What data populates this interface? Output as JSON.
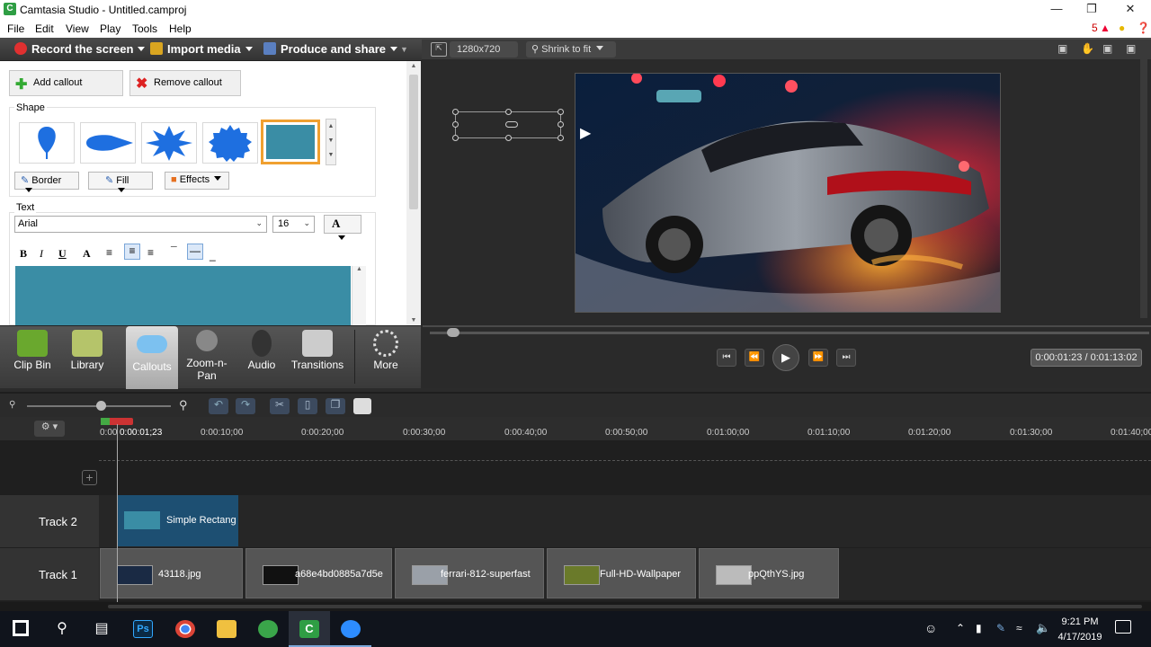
{
  "window": {
    "title": "Camtasia Studio - Untitled.camproj"
  },
  "menu": [
    "File",
    "Edit",
    "View",
    "Play",
    "Tools",
    "Help"
  ],
  "notifications_count": "5",
  "tasks": {
    "record": "Record the screen",
    "import": "Import media",
    "produce": "Produce and share"
  },
  "callouts": {
    "add": "Add callout",
    "remove": "Remove callout",
    "shape_label": "Shape",
    "border": "Border",
    "fill": "Fill",
    "effects": "Effects",
    "text_label": "Text",
    "font": "Arial",
    "size": "16",
    "text_color_glyph": "A",
    "fill_color": "#3a8da5"
  },
  "format": {
    "bold": "B",
    "italic": "I",
    "underline": "U",
    "color": "A"
  },
  "tools": [
    {
      "label": "Clip Bin"
    },
    {
      "label": "Library"
    },
    {
      "label": "Callouts"
    },
    {
      "label": "Zoom-n-\nPan"
    },
    {
      "label": "Audio"
    },
    {
      "label": "Transitions"
    },
    {
      "label": "More"
    }
  ],
  "preview": {
    "dimensions": "1280x720",
    "zoom": "Shrink to fit",
    "timecode": "0:00:01:23 / 0:01:13:02"
  },
  "timeline": {
    "playhead_label": "0:00:01;23",
    "ticks": [
      "0:00:10;00",
      "0:00:20;00",
      "0:00:30;00",
      "0:00:40;00",
      "0:00:50;00",
      "0:01:00;00",
      "0:01:10;00",
      "0:01:20;00",
      "0:01:30;00",
      "0:01:40;00"
    ],
    "start_tick": "0:00",
    "tracks": [
      {
        "name": "Track 2",
        "clips": [
          "Simple Rectangle"
        ]
      },
      {
        "name": "Track 1",
        "clips": [
          "43118.jpg",
          "a68e4bd0885a7d5e",
          "ferrari-812-superfast",
          "Full-HD-Wallpaper",
          "ppQthYS.jpg"
        ]
      }
    ]
  },
  "taskbar": {
    "time": "9:21 PM",
    "date": "4/17/2019"
  }
}
